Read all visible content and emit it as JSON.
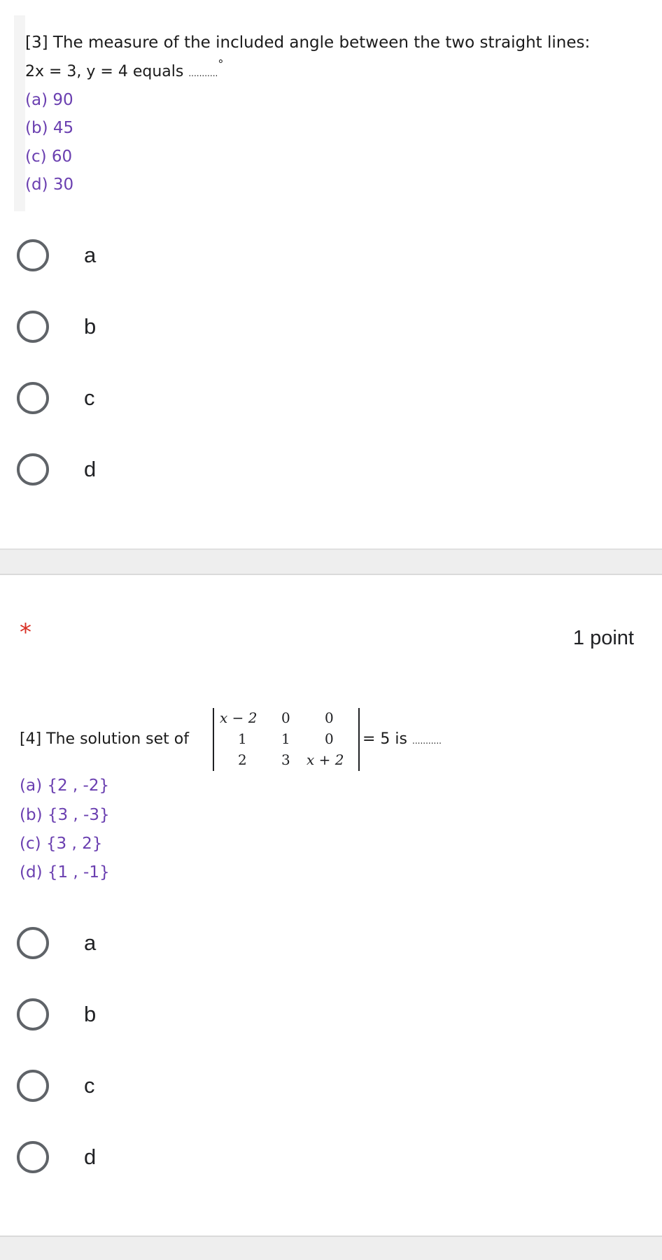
{
  "q3": {
    "text_line1": "[3] The measure of the included angle between the two straight lines:",
    "text_line2_eq": "2x = 3, y = 4 equals",
    "text_line2_blank": "...........",
    "degree_mark": "°",
    "options": [
      "(a) 90",
      "(b) 45",
      "(c) 60",
      "(d) 30"
    ],
    "choices": [
      "a",
      "b",
      "c",
      "d"
    ]
  },
  "q4": {
    "required_mark": "*",
    "points": "1 point",
    "text_prefix": "[4] The solution set of",
    "text_suffix": "= 5 is",
    "text_blank": "...........",
    "matrix": [
      [
        "x − 2",
        "0",
        "0"
      ],
      [
        "1",
        "1",
        "0"
      ],
      [
        "2",
        "3",
        "x + 2"
      ]
    ],
    "options": [
      "(a) {2 , -2}",
      "(b) {3 , -3}",
      "(c) {3 , 2}",
      "(d) {1 , -1}"
    ],
    "choices": [
      "a",
      "b",
      "c",
      "d"
    ]
  }
}
